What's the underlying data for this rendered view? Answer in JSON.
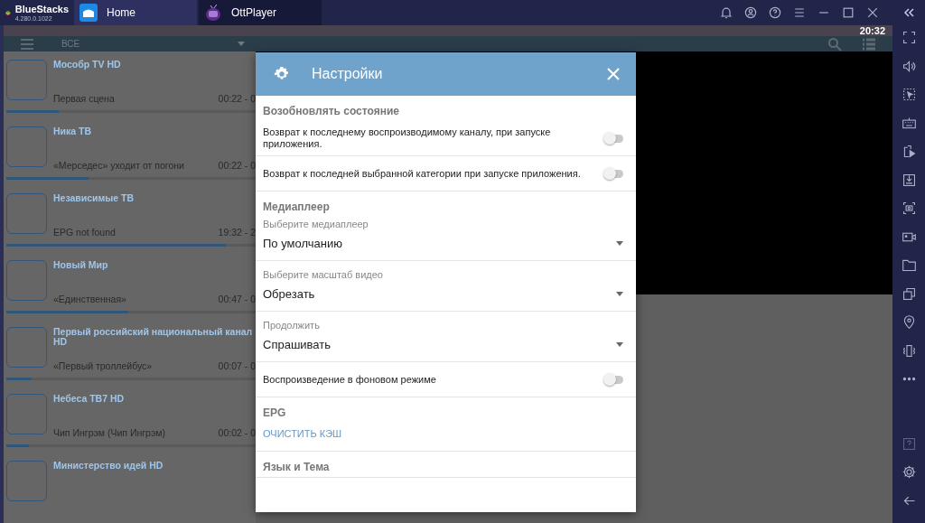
{
  "top_bar": {
    "brand": "BlueStacks",
    "version": "4.280.0.1022",
    "tabs": [
      {
        "label": "Home",
        "selected": false
      },
      {
        "label": "OttPlayer",
        "selected": true
      }
    ]
  },
  "status_bar": {
    "time": "20:32"
  },
  "app_bar": {
    "category": "ВСЕ"
  },
  "channels": [
    {
      "name": "Мособр TV HD",
      "program": "Первая сцена",
      "time": "00:22 - 0",
      "level": 0.21
    },
    {
      "name": "Ника ТВ",
      "program": "«Мерседес» уходит от погони",
      "time": "00:22 - 0",
      "level": 0.33
    },
    {
      "name": "Независимые ТВ",
      "program": "EPG not found",
      "time": "19:32 - 2",
      "level": 0.88
    },
    {
      "name": "Новый Мир",
      "program": "«Единственная»",
      "time": "00:47 - 0",
      "level": 0.49
    },
    {
      "name": "Первый российский национальный канал HD",
      "program": "«Первый троллейбус»",
      "time": "00:07 - 0",
      "level": 0.1
    },
    {
      "name": "Небеса ТВ7 HD",
      "program": "Чип Ингрэм (Чип Ингрэм)",
      "time": "00:02 - 0",
      "level": 0.09
    },
    {
      "name": "Министерство идей HD"
    }
  ],
  "settings": {
    "title": "Настройки",
    "sections": [
      {
        "title": "Возобновлять состояние",
        "items": [
          {
            "kind": "toggle",
            "label": "Возврат к последнему воспроизводимому каналу, при запуске приложения.",
            "on": false
          },
          {
            "kind": "toggle",
            "label": "Возврат к последней выбранной категории при запуске приложения.",
            "on": false
          }
        ]
      },
      {
        "title": "Медиаплеер",
        "items": [
          {
            "kind": "select",
            "label": "Выберите медиаплеер",
            "value": "По умолчанию"
          },
          {
            "kind": "select",
            "label": "Выберите масштаб видео",
            "value": "Обрезать"
          },
          {
            "kind": "select",
            "label": "Продолжить",
            "value": "Спрашивать"
          },
          {
            "kind": "toggle",
            "label": "Воспроизведение в фоновом режиме",
            "on": false
          }
        ]
      },
      {
        "title": "EPG",
        "items": [
          {
            "kind": "action",
            "label": "ОЧИСТИТЬ КЭШ"
          }
        ]
      },
      {
        "title": "Язык и Тема"
      }
    ]
  }
}
